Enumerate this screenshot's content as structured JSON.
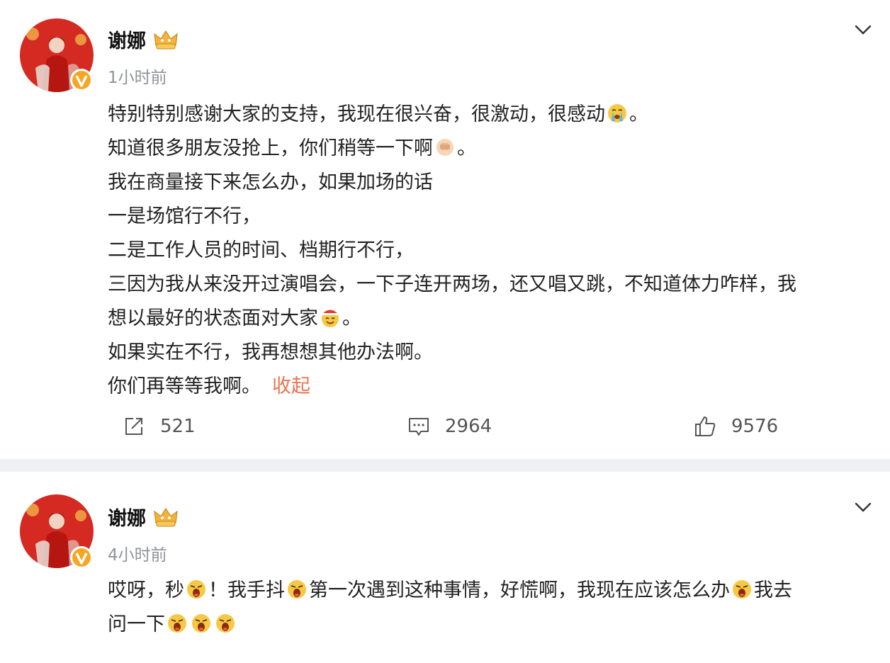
{
  "colors": {
    "accent_link": "#eb7350",
    "avatar_bg": "#d42a22",
    "verified_badge": "#f5a623",
    "divider": "#eef0f3",
    "timestamp": "#909399"
  },
  "posts": [
    {
      "author": "谢娜",
      "time": "1小时前",
      "badge_icon": "crown-member-icon",
      "lines": [
        [
          "特别特别感谢大家的支持，我现在很兴奋，很激动，很感动",
          "。"
        ],
        [
          "知道很多朋友没抢上，你们稍等一下啊",
          "。"
        ],
        [
          "我在商量接下来怎么办，如果加场的话"
        ],
        [
          "一是场馆行不行，"
        ],
        [
          "二是工作人员的时间、档期行不行，"
        ],
        [
          "三因为我从来没开过演唱会，一下子连开两场，还又唱又跳，不知道体力咋样，我"
        ],
        [
          "想以最好的状态面对大家",
          "。"
        ],
        [
          "如果实在不行，我再想想其他办法啊。"
        ],
        [
          "你们再等等我啊。"
        ]
      ],
      "collapse_label": "收起",
      "repost_count": "521",
      "comment_count": "2964",
      "like_count": "9576"
    },
    {
      "author": "谢娜",
      "time": "4小时前",
      "badge_icon": "crown-member-icon",
      "lines": [
        [
          "哎呀，秒",
          "！我手抖",
          "第一次遇到这种事情，好慌啊，我现在应该怎么办",
          "我去"
        ],
        [
          "问一下"
        ]
      ]
    }
  ]
}
